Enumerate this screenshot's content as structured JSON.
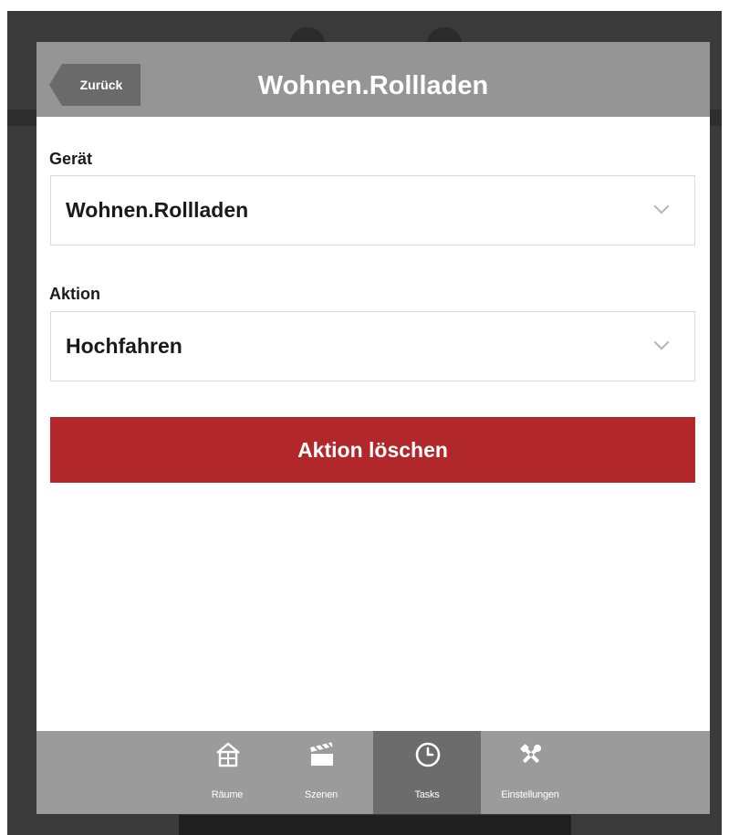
{
  "header": {
    "back_label": "Zurück",
    "title": "Wohnen.Rollladen"
  },
  "form": {
    "device_label": "Gerät",
    "device_value": "Wohnen.Rollladen",
    "action_label": "Aktion",
    "action_value": "Hochfahren",
    "delete_label": "Aktion löschen"
  },
  "colors": {
    "header_bg": "#959595",
    "back_button_bg": "#6a6a6a",
    "delete_button_bg": "#b1272a",
    "tabbar_bg": "#9b9b9b",
    "active_tab_bg": "#6c6c6c"
  },
  "tabs": [
    {
      "label": "Räume",
      "icon": "house-icon",
      "active": false
    },
    {
      "label": "Szenen",
      "icon": "clapperboard-icon",
      "active": false
    },
    {
      "label": "Tasks",
      "icon": "clock-icon",
      "active": true
    },
    {
      "label": "Einstellungen",
      "icon": "tools-icon",
      "active": false
    }
  ]
}
